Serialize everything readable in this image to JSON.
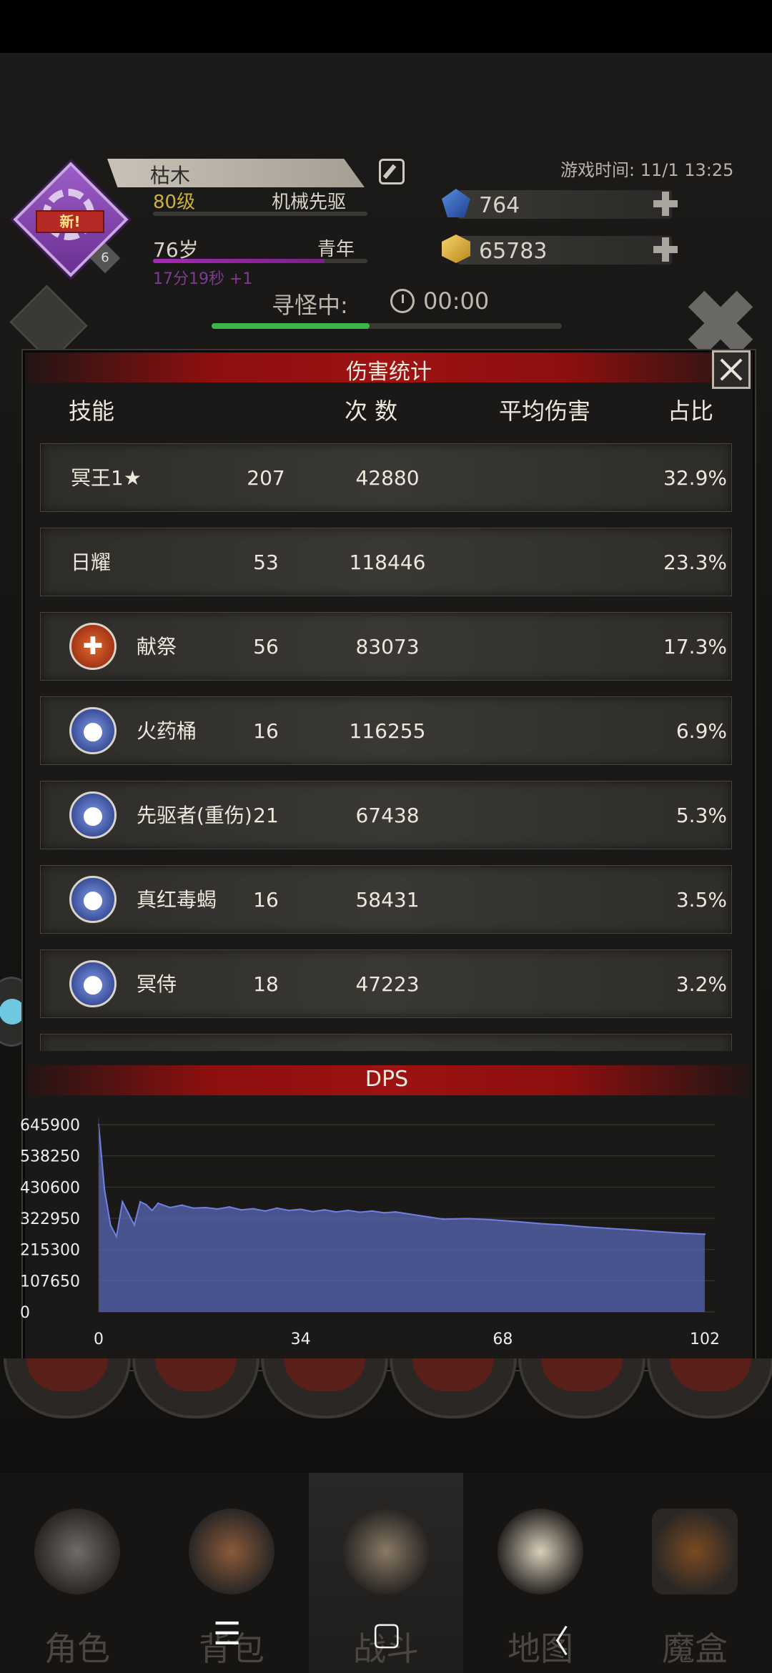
{
  "header": {
    "name": "枯木",
    "level": "80级",
    "class": "机械先驱",
    "new_badge": "新",
    "badge_number": "6",
    "age": "76岁",
    "age_stage": "青年",
    "time_counter": "17分19秒 +1",
    "game_time": "游戏时间: 11/1 13:25",
    "gems": "764",
    "gold": "65783",
    "search_label": "寻怪中:",
    "search_timer": "00:00",
    "search_progress_pct": 45
  },
  "damage_panel": {
    "title": "伤害统计",
    "columns": {
      "skill": "技能",
      "count": "次 数",
      "avg": "平均伤害",
      "share": "占比"
    },
    "rows": [
      {
        "name": "冥王1★",
        "count": "207",
        "avg": "42880",
        "share": "32.9%",
        "icon": ""
      },
      {
        "name": "日耀",
        "count": "53",
        "avg": "118446",
        "share": "23.3%",
        "icon": ""
      },
      {
        "name": "献祭",
        "count": "56",
        "avg": "83073",
        "share": "17.3%",
        "icon": "sacrifice-icon"
      },
      {
        "name": "火药桶",
        "count": "16",
        "avg": "116255",
        "share": "6.9%",
        "icon": "powder-keg-icon"
      },
      {
        "name": "先驱者(重伤)",
        "count": "21",
        "avg": "67438",
        "share": "5.3%",
        "icon": "pioneer-icon"
      },
      {
        "name": "真红毒蝎",
        "count": "16",
        "avg": "58431",
        "share": "3.5%",
        "icon": "scorpion-icon"
      },
      {
        "name": "冥侍",
        "count": "18",
        "avg": "47223",
        "share": "3.2%",
        "icon": "underworld-servant-icon"
      }
    ]
  },
  "dps_panel": {
    "title": "DPS"
  },
  "chart_data": {
    "type": "area",
    "title": "DPS",
    "xlabel": "",
    "ylabel": "",
    "x_ticks": [
      "0",
      "34",
      "68",
      "102"
    ],
    "y_ticks": [
      "645900",
      "538250",
      "430600",
      "322950",
      "215300",
      "107650",
      "0"
    ],
    "xlim": [
      0,
      102
    ],
    "ylim": [
      0,
      645900
    ],
    "grid": true,
    "color": "#5a68b8",
    "x": [
      0,
      1,
      2,
      3,
      4,
      5,
      6,
      7,
      8,
      9,
      10,
      12,
      14,
      16,
      18,
      20,
      22,
      24,
      26,
      28,
      30,
      32,
      34,
      36,
      38,
      40,
      42,
      44,
      46,
      48,
      50,
      54,
      58,
      62,
      66,
      70,
      74,
      78,
      82,
      86,
      90,
      94,
      98,
      102
    ],
    "values": [
      645900,
      420000,
      300000,
      260000,
      380000,
      340000,
      300000,
      380000,
      370000,
      350000,
      375000,
      360000,
      368000,
      358000,
      360000,
      355000,
      362000,
      352000,
      356000,
      348000,
      358000,
      350000,
      354000,
      346000,
      352000,
      345000,
      350000,
      344000,
      348000,
      342000,
      345000,
      332000,
      320000,
      322000,
      318000,
      312000,
      305000,
      300000,
      293000,
      288000,
      283000,
      277000,
      272000,
      268000
    ]
  },
  "bottom_nav": [
    {
      "label": "角色",
      "icon": "helmet-icon"
    },
    {
      "label": "背包",
      "icon": "backpack-icon"
    },
    {
      "label": "战斗",
      "icon": "sword-shield-icon"
    },
    {
      "label": "地图",
      "icon": "scroll-map-icon"
    },
    {
      "label": "魔盒",
      "icon": "magic-box-icon"
    }
  ],
  "system_nav": {
    "menu": "☰",
    "home": "▢",
    "back": "〈"
  }
}
